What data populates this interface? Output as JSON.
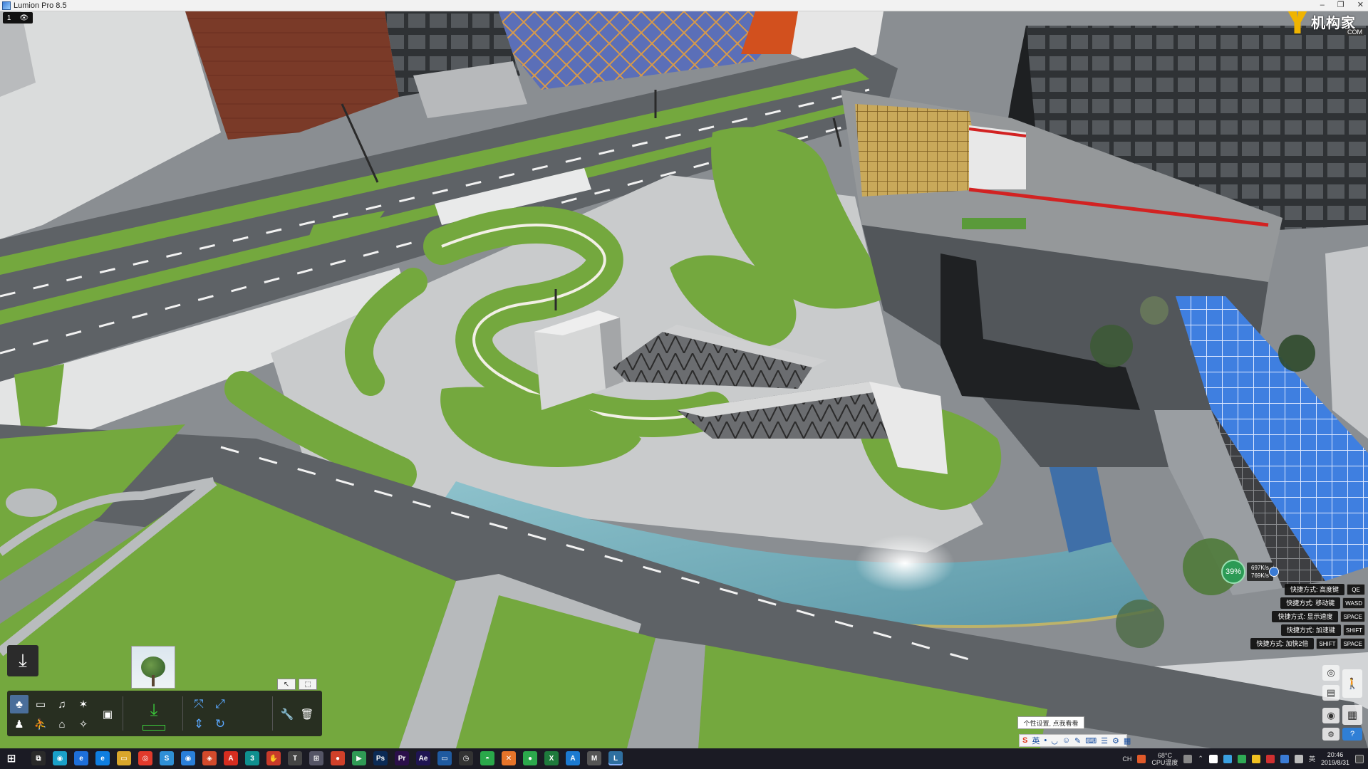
{
  "window": {
    "title": "Lumion Pro 8.5",
    "minimize": "–",
    "restore": "❐",
    "close": "✕"
  },
  "view_toggle": {
    "index": "1",
    "eye": "👁"
  },
  "logo": {
    "brand": "机构家",
    "suffix": "COM"
  },
  "build_toolbar": {
    "place_icon": "⤓",
    "mini_tools": [
      "↖",
      "⬚"
    ],
    "categories": [
      {
        "name": "nature",
        "glyph": "♣"
      },
      {
        "name": "vehicles",
        "glyph": "▭"
      },
      {
        "name": "sound",
        "glyph": "♫"
      },
      {
        "name": "effects",
        "glyph": "✶"
      },
      {
        "name": "people",
        "glyph": "♟"
      },
      {
        "name": "indoor",
        "glyph": "⛹"
      },
      {
        "name": "outdoor",
        "glyph": "⌂"
      },
      {
        "name": "lights",
        "glyph": "✧"
      },
      {
        "name": "import",
        "glyph": "▣"
      }
    ],
    "place_object": "⤓",
    "transform": [
      "⤧",
      "⤢",
      "⇕",
      "↻"
    ],
    "wrench": "🔧",
    "trash": "🗑"
  },
  "net_gauge": {
    "percent": "39%",
    "up": "697K/s",
    "down": "769K/s"
  },
  "shortcuts": [
    {
      "label": "快捷方式: 高度键",
      "keys": [
        "QE"
      ]
    },
    {
      "label": "快捷方式: 移动键",
      "keys": [
        "WASD"
      ]
    },
    {
      "label": "快捷方式: 显示速度",
      "keys": [
        "SPACE"
      ]
    },
    {
      "label": "快捷方式: 加速键",
      "keys": [
        "SHIFT"
      ]
    },
    {
      "label": "快捷方式: 加快2倍",
      "keys": [
        "SHIFT",
        "SPACE"
      ]
    }
  ],
  "right_nav": {
    "camera": "◎",
    "walk": "🚶",
    "film": "▤",
    "globe": "◉",
    "save": "▦",
    "settings": "⚙",
    "help": "?"
  },
  "tooltip": "个性设置, 点我看看",
  "ime": {
    "logo": "S",
    "mode": "英",
    "items": [
      "•",
      "◡",
      "☺",
      "✎",
      "⌨",
      "☰",
      "⚙",
      "▦"
    ]
  },
  "taskbar": {
    "start": "⊞",
    "apps": [
      {
        "label": "⧉",
        "color": "#2a2a2a"
      },
      {
        "label": "◉",
        "color": "#1aa0c8"
      },
      {
        "label": "e",
        "color": "#1e6fd9"
      },
      {
        "label": "e",
        "color": "#0f7ee0"
      },
      {
        "label": "▭",
        "color": "#d9a62b"
      },
      {
        "label": "◎",
        "color": "#e23a2c"
      },
      {
        "label": "S",
        "color": "#2f8fd6"
      },
      {
        "label": "◉",
        "color": "#2a7fd9"
      },
      {
        "label": "◈",
        "color": "#d24a2c"
      },
      {
        "label": "A",
        "color": "#d62d20"
      },
      {
        "label": "3",
        "color": "#0f8f8f"
      },
      {
        "label": "✋",
        "color": "#c83a2a"
      },
      {
        "label": "T",
        "color": "#444"
      },
      {
        "label": "⊞",
        "color": "#556"
      },
      {
        "label": "●",
        "color": "#d0402a"
      },
      {
        "label": "▶",
        "color": "#2f9a55"
      },
      {
        "label": "Ps",
        "color": "#0b2a55"
      },
      {
        "label": "Pr",
        "color": "#2b0f4a"
      },
      {
        "label": "Ae",
        "color": "#1f1452"
      },
      {
        "label": "▭",
        "color": "#1f5aa0"
      },
      {
        "label": "◷",
        "color": "#333"
      },
      {
        "label": "◓",
        "color": "#2aa84a"
      },
      {
        "label": "✕",
        "color": "#e6742a"
      },
      {
        "label": "●",
        "color": "#2ca84c"
      },
      {
        "label": "X",
        "color": "#1e7a3c"
      },
      {
        "label": "A",
        "color": "#1c7ad0"
      },
      {
        "label": "M",
        "color": "#555"
      },
      {
        "label": "L",
        "color": "#2f6fa0"
      }
    ],
    "cpu_temp": "68°C",
    "cpu_label": "CPU温度",
    "time": "20:46",
    "date": "2019/8/31",
    "lang": "英",
    "ch": "CH"
  },
  "colors": {
    "grass": "#74a83e",
    "road": "#5e6266",
    "plaza": "#c9cbcc",
    "water": "#6fa9b6",
    "glass_blue": "#3f7fe0",
    "accent_gauge": "#2c9a55"
  }
}
